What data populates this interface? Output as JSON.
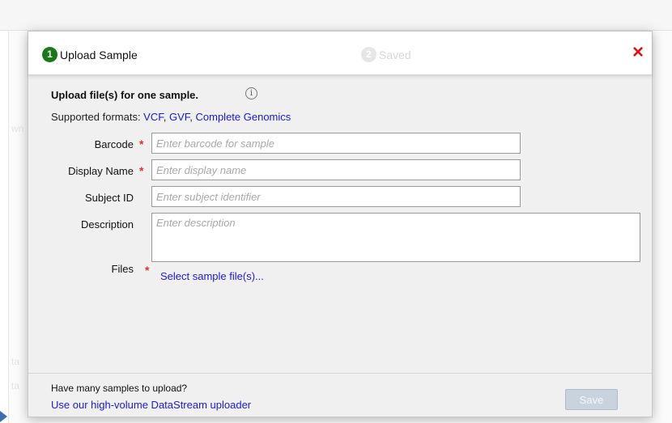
{
  "background": {
    "snippets": [
      "wn",
      "ta",
      "ta"
    ]
  },
  "dialog": {
    "steps": [
      {
        "number": "1",
        "label": "Upload Sample"
      },
      {
        "number": "2",
        "label": "Saved"
      }
    ],
    "close_icon": "×",
    "intro": "Upload file(s) for one sample.",
    "info_glyph": "i",
    "formats_prefix": "Supported formats: ",
    "formats": [
      "VCF",
      "GVF",
      "Complete Genomics"
    ],
    "formats_separator": ", ",
    "fields": {
      "barcode": {
        "label": "Barcode",
        "placeholder": "Enter barcode for sample",
        "required": true
      },
      "display_name": {
        "label": "Display Name",
        "placeholder": "Enter display name",
        "required": true
      },
      "subject_id": {
        "label": "Subject ID",
        "placeholder": "Enter subject identifier",
        "required": false
      },
      "description": {
        "label": "Description",
        "placeholder": "Enter description",
        "required": false
      },
      "files": {
        "label": "Files",
        "required": true,
        "link": "Select sample file(s)..."
      }
    },
    "required_marker": "*",
    "footer": {
      "question": "Have many samples to upload?",
      "link": "Use our high-volume DataStream uploader",
      "save_label": "Save"
    }
  },
  "colors": {
    "step_active": "#1a7a1a",
    "close": "#e01010",
    "link": "#1a1ae0",
    "required": "#e03030",
    "save_disabled": "#c9d3de"
  }
}
